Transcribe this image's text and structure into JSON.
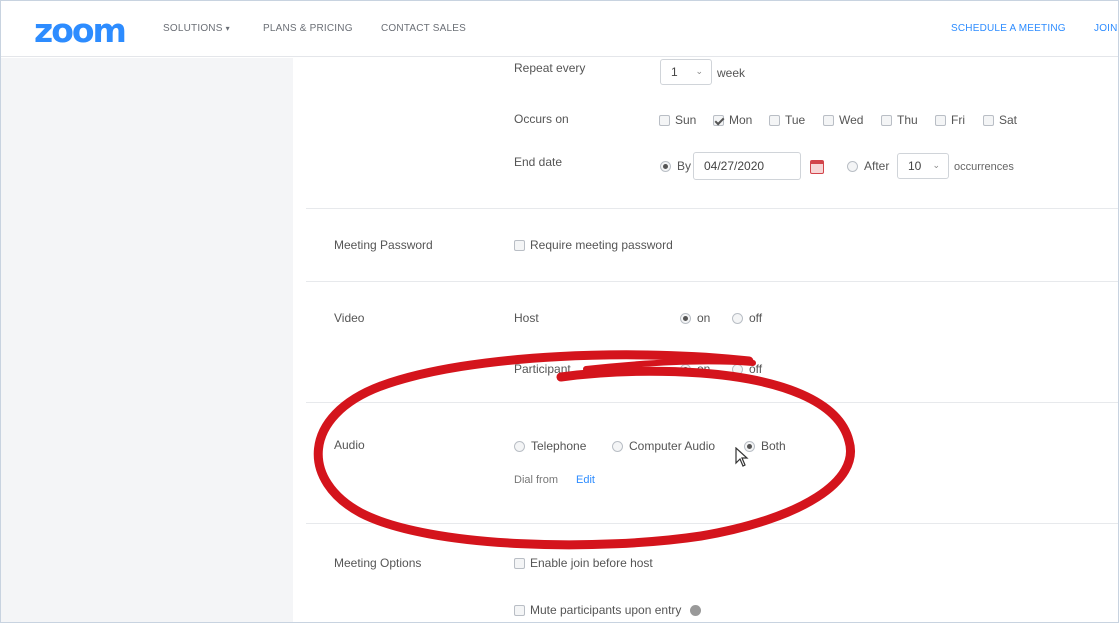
{
  "nav": {
    "logo": "zoom",
    "solutions": "SOLUTIONS",
    "plans": "PLANS & PRICING",
    "contact": "CONTACT SALES",
    "schedule": "SCHEDULE A MEETING",
    "join": "JOIN"
  },
  "recurrence": {
    "repeat_label": "Repeat every",
    "repeat_value": "1",
    "repeat_unit": "week",
    "occurs_label": "Occurs on",
    "days": [
      {
        "label": "Sun",
        "checked": false
      },
      {
        "label": "Mon",
        "checked": true
      },
      {
        "label": "Tue",
        "checked": false
      },
      {
        "label": "Wed",
        "checked": false
      },
      {
        "label": "Thu",
        "checked": false
      },
      {
        "label": "Fri",
        "checked": false
      },
      {
        "label": "Sat",
        "checked": false
      }
    ],
    "end_label": "End date",
    "by_label": "By",
    "by_date": "04/27/2020",
    "after_label": "After",
    "after_value": "10",
    "occurrences_label": "occurrences"
  },
  "password": {
    "label": "Meeting Password",
    "option": "Require meeting password"
  },
  "video": {
    "label": "Video",
    "host_label": "Host",
    "participant_label": "Participant",
    "on": "on",
    "off": "off"
  },
  "audio": {
    "label": "Audio",
    "telephone": "Telephone",
    "computer": "Computer Audio",
    "both": "Both",
    "dial_from": "Dial from",
    "edit": "Edit"
  },
  "options": {
    "label": "Meeting Options",
    "join_before_host": "Enable join before host",
    "mute_on_entry": "Mute participants upon entry"
  },
  "colors": {
    "brand": "#2d8cff",
    "annotation": "#d4141c"
  }
}
